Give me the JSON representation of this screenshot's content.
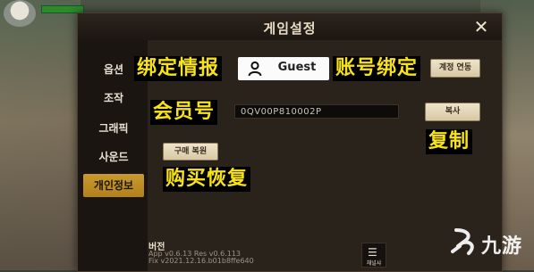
{
  "dialog": {
    "title": "게임설정"
  },
  "sidebar": {
    "items": [
      {
        "label": "옵션"
      },
      {
        "label": "조작"
      },
      {
        "label": "그래픽"
      },
      {
        "label": "사운드"
      },
      {
        "label": "개인정보",
        "active": true
      }
    ]
  },
  "annotations": {
    "bind_info": "绑定情报",
    "account_bind": "账号绑定",
    "member_no": "会员号",
    "copy": "复制",
    "restore": "购买恢复"
  },
  "account": {
    "guest_label": "Guest",
    "link_button": "계정 연동"
  },
  "member": {
    "id_value": "0QV00P810002P",
    "copy_button": "복사"
  },
  "purchase": {
    "restore_button": "구매 복원"
  },
  "version": {
    "label": "버전",
    "lines": [
      "App v0.6.13 Res v0.6.113",
      "Fix v2021.12.16.b01b8ffe640"
    ]
  },
  "menu_button": {
    "caption": "채널샤"
  },
  "watermark": {
    "text": "九游"
  },
  "colors": {
    "accent": "#c99a2e",
    "annotation": "#f8e21a"
  }
}
